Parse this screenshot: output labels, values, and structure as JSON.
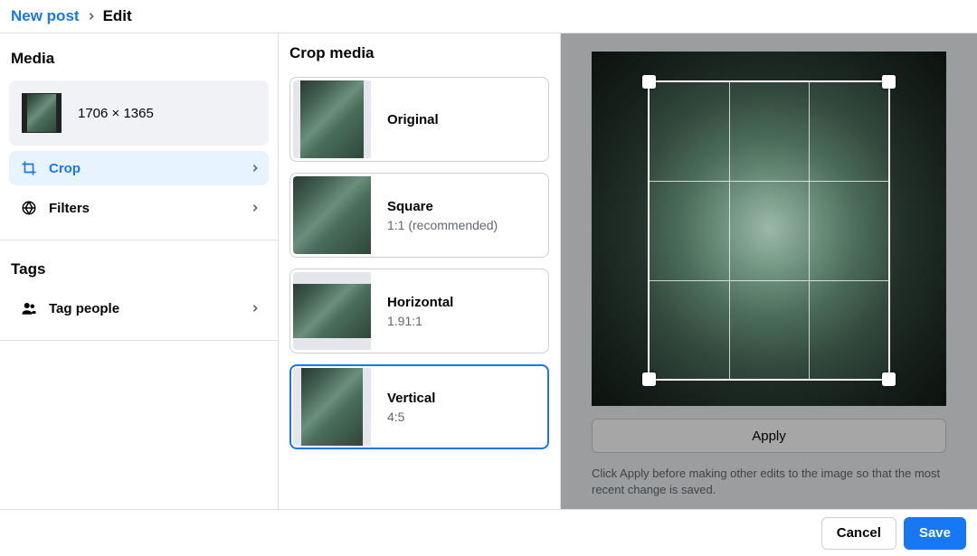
{
  "breadcrumb": {
    "root": "New post",
    "current": "Edit"
  },
  "sidebar": {
    "media_title": "Media",
    "image_dimensions": "1706 × 1365",
    "crop_label": "Crop",
    "filters_label": "Filters",
    "tags_title": "Tags",
    "tag_people_label": "Tag people"
  },
  "crop_panel": {
    "title": "Crop media",
    "options": [
      {
        "name": "Original",
        "sub": ""
      },
      {
        "name": "Square",
        "sub": "1:1 (recommended)"
      },
      {
        "name": "Horizontal",
        "sub": "1.91:1"
      },
      {
        "name": "Vertical",
        "sub": "4:5"
      }
    ]
  },
  "preview": {
    "apply_label": "Apply",
    "hint": "Click Apply before making other edits to the image so that the most recent change is saved."
  },
  "footer": {
    "cancel": "Cancel",
    "save": "Save"
  }
}
